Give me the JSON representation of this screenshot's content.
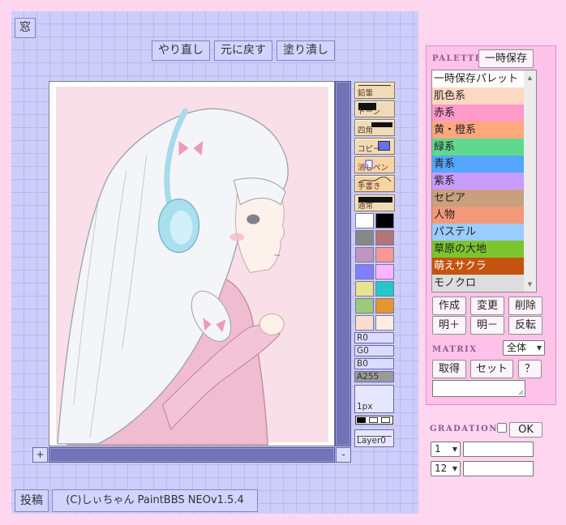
{
  "window_button": "窓",
  "toolbar": {
    "redo": "やり直し",
    "undo": "元に戻す",
    "fill": "塗り潰し"
  },
  "canvas": {
    "zoom_in": "+",
    "zoom_out": "-"
  },
  "tools": [
    "鉛筆",
    "トーン",
    "四角",
    "コピー",
    "消しペン",
    "手書き",
    "通常"
  ],
  "palette_colors": [
    "#ffffff",
    "#000000",
    "#888888",
    "#b47575",
    "#c096c0",
    "#fa9696",
    "#8080ff",
    "#ffb6ff",
    "#e7e58d",
    "#25c7c9",
    "#99cb7b",
    "#e7962d",
    "#f9ddcf",
    "#fcece2"
  ],
  "sliders": [
    {
      "label": "R0",
      "level": 0
    },
    {
      "label": "G0",
      "level": 0
    },
    {
      "label": "B0",
      "level": 0
    },
    {
      "label": "A255",
      "level": 1
    }
  ],
  "pen_size": "1px",
  "layer": "Layer0",
  "footer": {
    "post": "投稿",
    "copyright": "(C)しぃちゃん PaintBBS NEOv1.5.4"
  },
  "palette_panel": {
    "heading": "PALETTE",
    "save_button": "一時保存",
    "items": [
      {
        "label": "一時保存パレット",
        "color": "#ffffff"
      },
      {
        "label": "肌色系",
        "color": "#fdd9c3"
      },
      {
        "label": "赤系",
        "color": "#fd9ac9"
      },
      {
        "label": "黄・橙系",
        "color": "#ffa87e"
      },
      {
        "label": "緑系",
        "color": "#5fd98f"
      },
      {
        "label": "青系",
        "color": "#55a6ff"
      },
      {
        "label": "紫系",
        "color": "#c99cff"
      },
      {
        "label": "セピア",
        "color": "#c8a07f"
      },
      {
        "label": "人物",
        "color": "#f2997a"
      },
      {
        "label": "パステル",
        "color": "#99ccff"
      },
      {
        "label": "草原の大地",
        "color": "#7dc42d"
      },
      {
        "label": "萌えサクラ",
        "color": "#c4540f",
        "text": "#ffffff"
      },
      {
        "label": "モノクロ",
        "color": "#dddddd"
      }
    ],
    "buttons": {
      "create": "作成",
      "change": "変更",
      "delete": "削除",
      "brighter": "明＋",
      "darker": "明－",
      "invert": "反転"
    }
  },
  "matrix": {
    "heading": "MATRIX",
    "scope": "全体",
    "get": "取得",
    "set": "セット",
    "help": "？"
  },
  "gradation": {
    "heading": "GRADATION",
    "ok": "OK",
    "enabled": false,
    "start": "1",
    "end": "12"
  },
  "theme": {
    "page_bg": "#ffd6ef",
    "workspace_bg": "#cdcdfa",
    "scrollbar": "#7272b6",
    "side_panel_bg": "#ffc2e9",
    "heading": "#8c5c8c"
  }
}
